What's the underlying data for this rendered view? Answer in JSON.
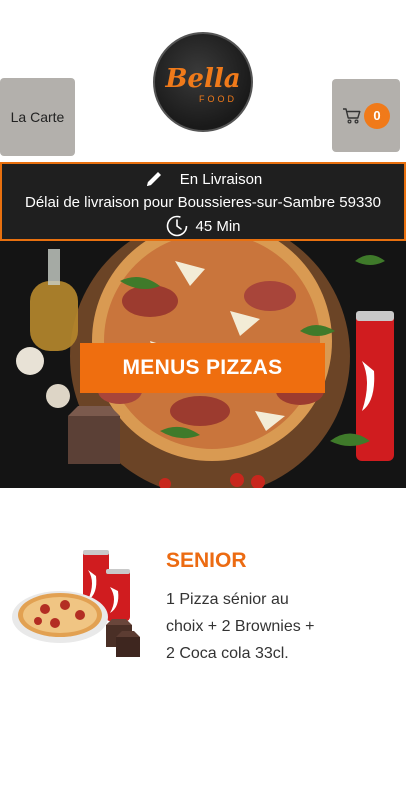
{
  "header": {
    "menu_label": "La Carte",
    "cart_count": "0",
    "logo_main": "Bella",
    "logo_sub": "FOOD"
  },
  "delivery": {
    "mode": "En Livraison",
    "delay_text": "Délai de livraison pour Boussieres-sur-Sambre 59330",
    "time": "45 Min"
  },
  "hero": {
    "button_label": "MENUS PIZZAS"
  },
  "product": {
    "title": "SENIOR",
    "description": "1 Pizza sénior au choix + 2 Brownies + 2 Coca cola 33cl."
  },
  "colors": {
    "accent": "#ef6e0f",
    "banner_bg": "#1f1f1f",
    "button_gray": "#b3b0ac"
  }
}
